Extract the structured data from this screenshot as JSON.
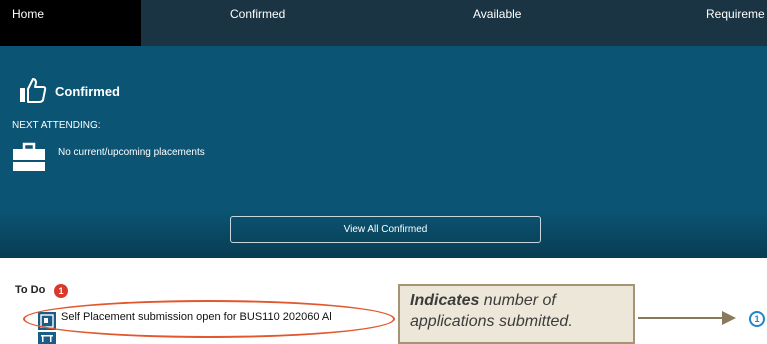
{
  "nav": {
    "tabs": [
      {
        "label": "Home",
        "active": true
      },
      {
        "label": "Confirmed"
      },
      {
        "label": "Available"
      },
      {
        "label": "Requireme"
      }
    ]
  },
  "confirmed_panel": {
    "icon": "thumbs-up-icon",
    "title": "Confirmed",
    "next_attending_label": "NEXT ATTENDING:",
    "placement_icon": "briefcase-icon",
    "no_placements_text": "No current/upcoming placements",
    "view_all_label": "View All Confirmed"
  },
  "todo": {
    "title": "To Do",
    "count": "1",
    "item_icon": "document-icon",
    "item_text": "Self Placement submission open for BUS110 202060 Al"
  },
  "annotation": {
    "emphasis": "Indicates",
    "text": " number of applications submitted.",
    "step_number": "1"
  },
  "colors": {
    "nav_bg": "#1b3444",
    "nav_active_bg": "#000000",
    "panel_bg": "#0b5473",
    "badge": "#d9382c",
    "highlight": "#e2572d",
    "callout_bg": "#ece7d8",
    "callout_border": "#a69574",
    "step_circle": "#1f86c8"
  }
}
